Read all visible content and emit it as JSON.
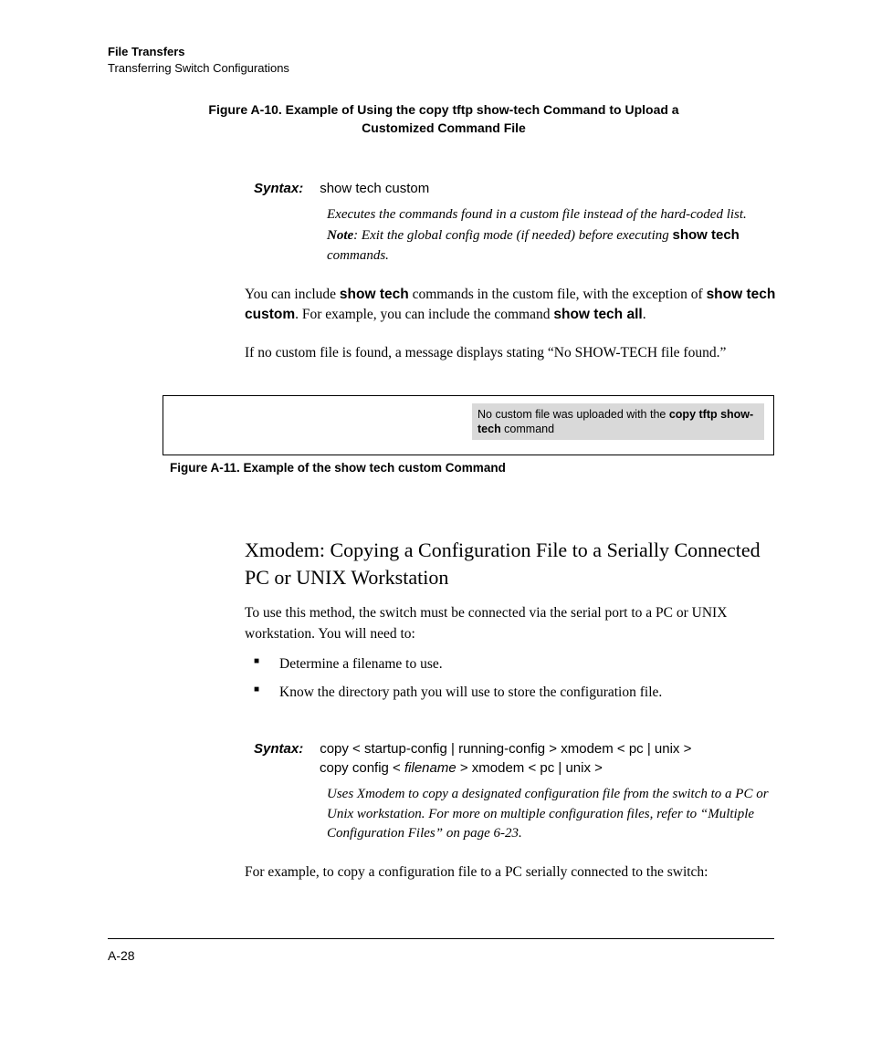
{
  "header": {
    "line1": "File Transfers",
    "line2": "Transferring Switch Configurations"
  },
  "fig10": {
    "caption": "Figure A-10. Example of Using the copy tftp show-tech Command to Upload a Customized Command File"
  },
  "syntax1": {
    "label": "Syntax:",
    "command": "show tech custom",
    "desc_line1": "Executes the commands found in a custom file instead of the hard-coded list.",
    "note_word": "Note",
    "note_rest": ": Exit the global config mode (if needed) before executing ",
    "note_bold": "show tech",
    "note_tail": " commands."
  },
  "para1_a": "You can include ",
  "para1_b": "show tech",
  "para1_c": " commands in the custom file, with the exception of ",
  "para1_d": "show tech custom",
  "para1_e": ". For example, you can include the command ",
  "para1_f": "show tech all",
  "para1_g": ".",
  "para2": "If no custom file is found, a message displays stating “No SHOW-TECH file found.”",
  "box_note_a": "No custom file was uploaded with the ",
  "box_note_b": "copy tftp show-tech",
  "box_note_c": " command",
  "fig11": "Figure A-11. Example of the show tech custom Command",
  "heading": "Xmodem: Copying a Configuration File to a Serially Connected PC or UNIX Workstation",
  "para3": "To use this method, the switch must be connected via the serial port to a PC or UNIX workstation. You will need to:",
  "bullets": [
    "Determine a filename to use.",
    "Know the directory path you will use to store the configuration file."
  ],
  "syntax2": {
    "label": "Syntax:",
    "line1": "copy < startup-config | running-config > xmodem < pc | unix >",
    "line2_a": "copy config < ",
    "line2_b": "filename",
    "line2_c": " > xmodem < pc | unix >",
    "desc": "Uses Xmodem to copy a designated configuration file from the switch to a PC or Unix workstation. For more on multiple configuration files, refer to “Multiple Configuration Files” on page 6-23."
  },
  "para4": "For example, to copy a configuration file to a PC serially connected to the switch:",
  "pagenum": "A-28"
}
